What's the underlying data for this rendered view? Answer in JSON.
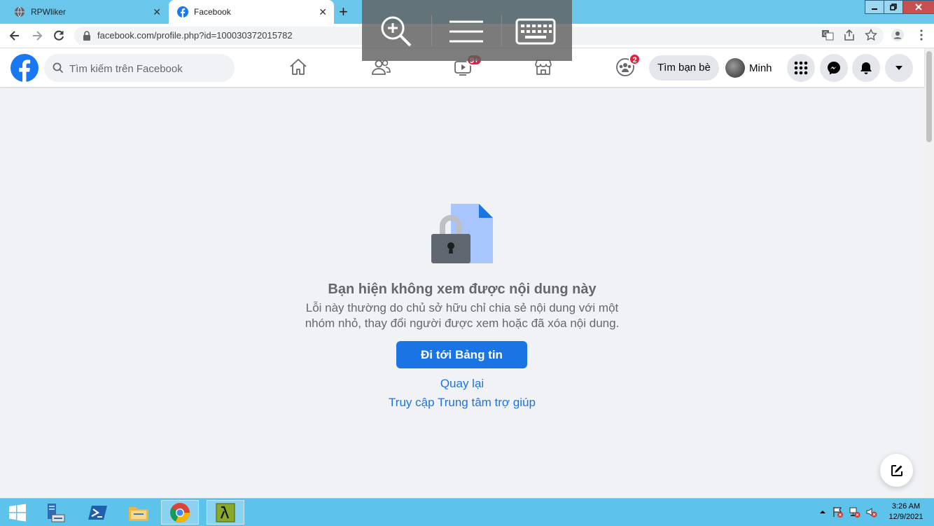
{
  "browser": {
    "tabs": [
      {
        "title": "RPWliker"
      },
      {
        "title": "Facebook"
      }
    ],
    "url": "facebook.com/profile.php?id=100030372015782"
  },
  "fb_nav": {
    "search_placeholder": "Tìm kiếm trên Facebook",
    "watch_badge": "9+",
    "groups_badge": "2",
    "find_friends_label": "Tìm bạn bè",
    "profile_name": "Minh"
  },
  "error": {
    "title": "Bạn hiện không xem được nội dung này",
    "description": "Lỗi này thường do chủ sở hữu chỉ chia sẻ nội dung với một nhóm nhỏ, thay đổi người được xem hoặc đã xóa nội dung.",
    "go_feed_label": "Đi tới Bảng tin",
    "back_label": "Quay lại",
    "help_label": "Truy cập Trung tâm trợ giúp"
  },
  "taskbar": {
    "time": "3:26 AM",
    "date": "12/9/2021"
  },
  "colors": {
    "fb_blue": "#1b74e4",
    "taskbar": "#5ec3ea",
    "badge_red": "#e41e3f"
  }
}
